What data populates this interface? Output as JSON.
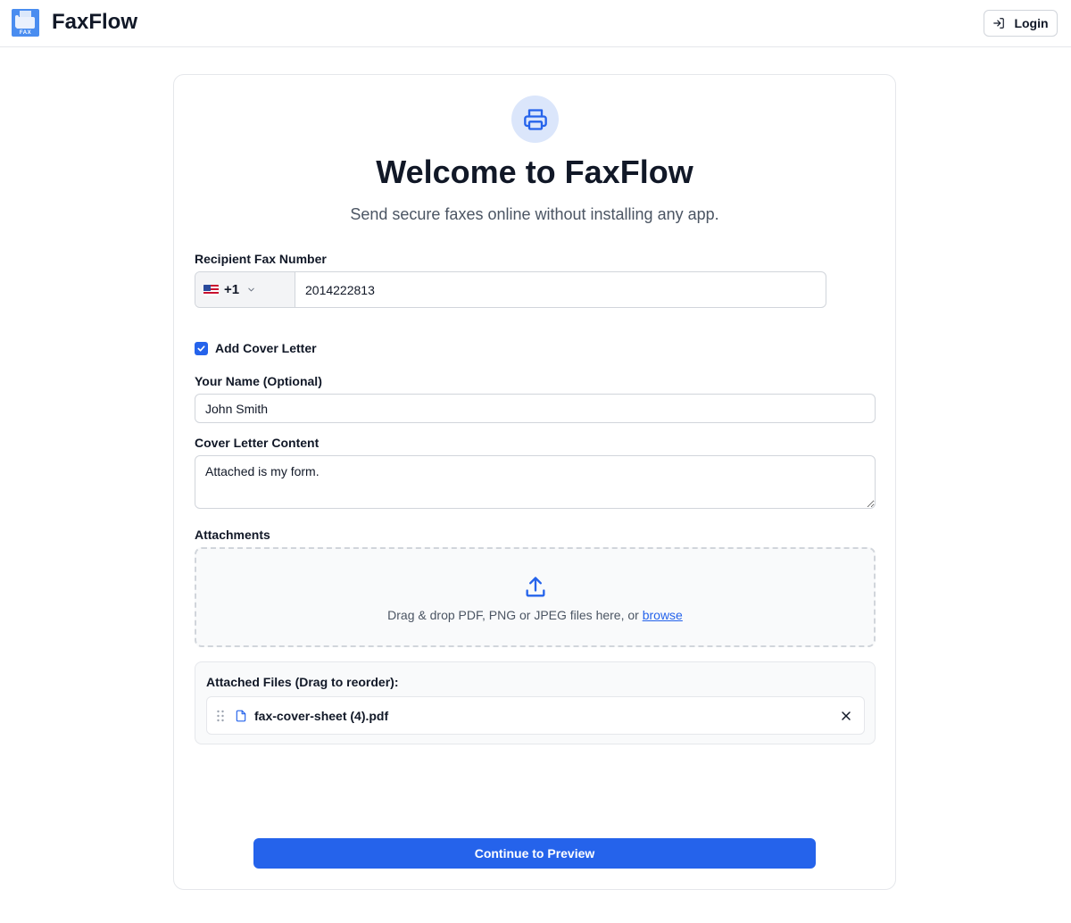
{
  "header": {
    "logo_tag": "FAX",
    "brand": "FaxFlow",
    "login_label": "Login"
  },
  "hero": {
    "icon": "printer-icon",
    "title": "Welcome to FaxFlow",
    "subtitle": "Send secure faxes online without installing any app."
  },
  "form": {
    "recipient_label": "Recipient Fax Number",
    "country_code": "+1",
    "country_flag": "us-flag",
    "fax_number": "2014222813",
    "cover_letter_checkbox_label": "Add Cover Letter",
    "cover_letter_checked": true,
    "name_label": "Your Name (Optional)",
    "name_value": "John Smith",
    "content_label": "Cover Letter Content",
    "content_value": "Attached is my form."
  },
  "attachments": {
    "label": "Attachments",
    "drop_text": "Drag & drop PDF, PNG or JPEG files here, or",
    "browse_label": "browse",
    "files_title": "Attached Files (Drag to reorder):",
    "files": [
      {
        "name": "fax-cover-sheet (4).pdf"
      }
    ]
  },
  "actions": {
    "continue_label": "Continue to Preview"
  },
  "colors": {
    "primary": "#2563eb",
    "hero_circle": "#dbe6fb",
    "logo_blue": "#4a8df0"
  }
}
